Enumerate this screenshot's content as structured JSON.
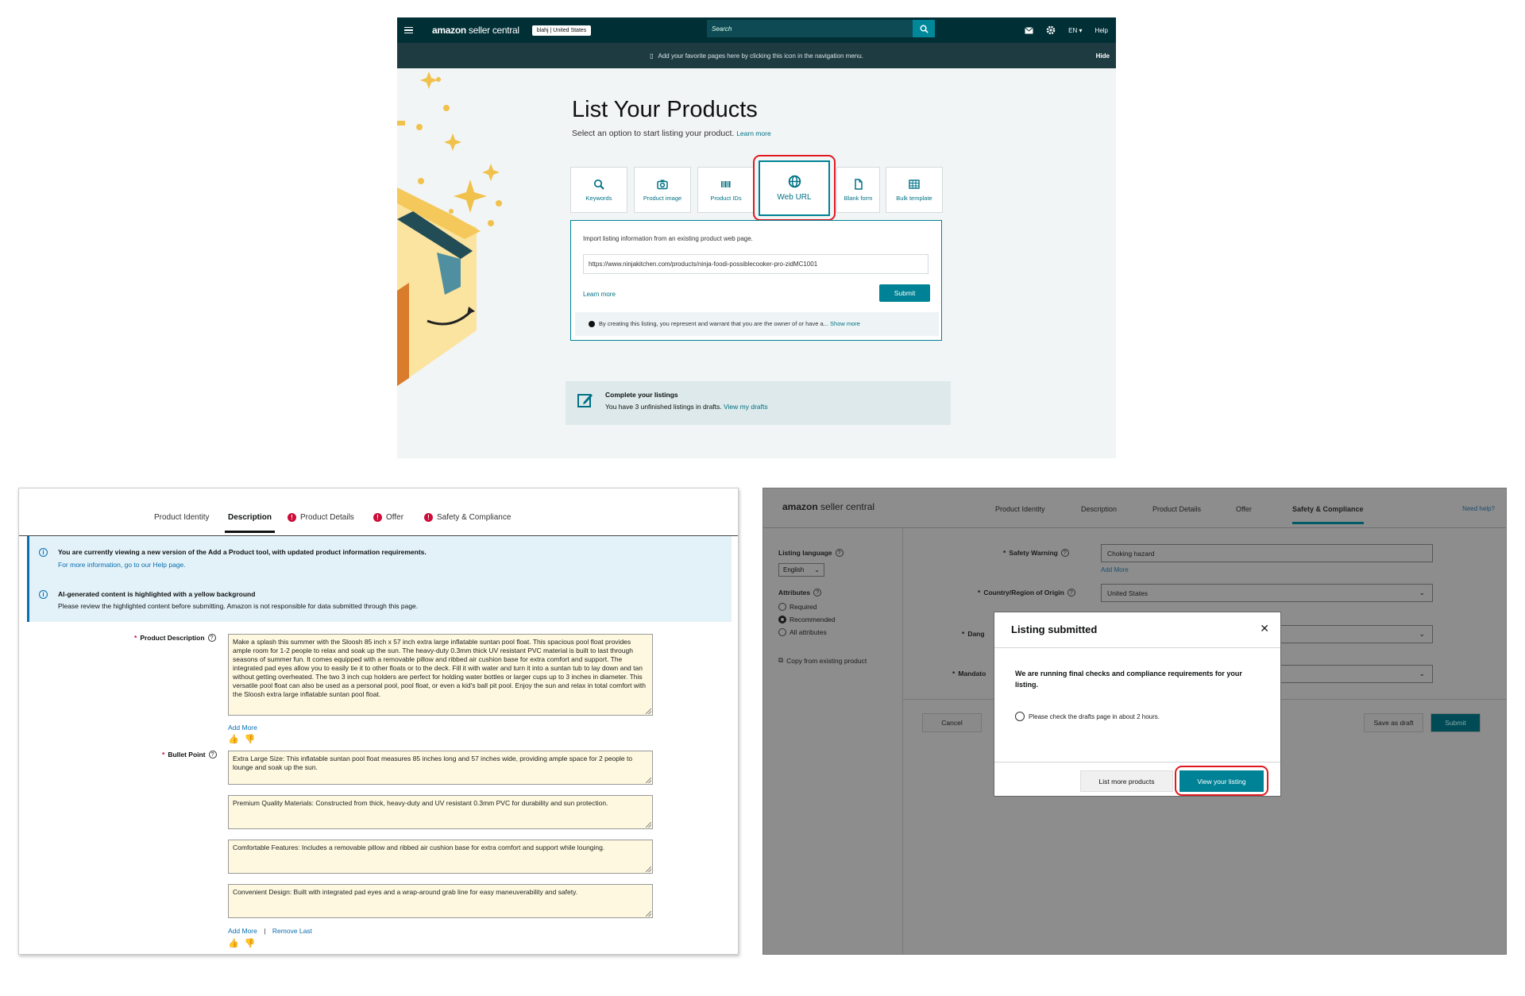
{
  "panel1": {
    "topbar": {
      "logo_main": "amazon",
      "logo_sub": " seller central",
      "marketplace": "blahj | United States",
      "search_placeholder": "Search",
      "language": "EN",
      "help": "Help"
    },
    "favbar": {
      "text": "Add your favorite pages here by clicking this icon in the navigation menu.",
      "hide": "Hide"
    },
    "title": "List Your Products",
    "subtitle": "Select an option to start listing your product.",
    "learn_more": "Learn more",
    "tiles": [
      {
        "label": "Keywords",
        "icon": "magnifier-icon"
      },
      {
        "label": "Product image",
        "icon": "camera-icon"
      },
      {
        "label": "Product IDs",
        "icon": "barcode-icon"
      },
      {
        "label": "Web URL",
        "icon": "globe-icon"
      },
      {
        "label": "Blank form",
        "icon": "document-icon"
      },
      {
        "label": "Bulk template",
        "icon": "spreadsheet-icon"
      }
    ],
    "url_panel": {
      "label": "Import listing information from an existing product web page.",
      "url_value": "https://www.ninjakitchen.com/products/ninja-foodi-possiblecooker-pro-zidMC1001",
      "learn_more": "Learn more",
      "submit": "Submit",
      "notice": "By creating this listing, you represent and warrant that you are the owner of or have a...",
      "show_more": "Show more"
    },
    "drafts": {
      "title": "Complete your listings",
      "text": "You have 3 unfinished listings in drafts.",
      "link": "View my drafts"
    }
  },
  "panel2": {
    "tabs": [
      {
        "label": "Product Identity",
        "error": false,
        "selected": false
      },
      {
        "label": "Description",
        "error": false,
        "selected": true
      },
      {
        "label": "Product Details",
        "error": true,
        "selected": false
      },
      {
        "label": "Offer",
        "error": true,
        "selected": false
      },
      {
        "label": "Safety & Compliance",
        "error": true,
        "selected": false
      }
    ],
    "info1_bold": "You are currently viewing a new version of the Add a Product tool, with updated product information requirements.",
    "info1_link": "For more information, go to our Help page.",
    "info2_bold": "AI-generated content is highlighted with a yellow background",
    "info2_text": "Please review the highlighted content before submitting. Amazon is not responsible for data submitted through this page.",
    "product_description_label": "Product Description",
    "product_description": "Make a splash this summer with the Sloosh 85 inch x 57 inch extra large inflatable suntan pool float. This spacious pool float provides ample room for 1-2 people to relax and soak up the sun. The heavy-duty 0.3mm thick UV resistant PVC material is built to last through seasons of summer fun. It comes equipped with a removable pillow and ribbed air cushion base for extra comfort and support. The integrated pad eyes allow you to easily tie it to other floats or to the deck. Fill it with water and turn it into a suntan tub to lay down and tan without getting overheated. The two 3 inch cup holders are perfect for holding water bottles or larger cups up to 3 inches in diameter. This versatile pool float can also be used as a personal pool, pool float, or even a kid's ball pit pool. Enjoy the sun and relax in total comfort with the Sloosh extra large inflatable suntan pool float.",
    "add_more": "Add More",
    "bullet_label": "Bullet Point",
    "bullets": [
      "Extra Large Size: This inflatable suntan pool float measures 85 inches long and 57 inches wide, providing ample space for 2 people to lounge and soak up the sun.",
      "Premium Quality Materials: Constructed from thick, heavy-duty and UV resistant 0.3mm PVC for durability and sun protection.",
      "Comfortable Features: Includes a removable pillow and ribbed air cushion base for extra comfort and support while lounging.",
      "Convenient Design: Built with integrated pad eyes and a wrap-around grab line for easy maneuverability and safety."
    ],
    "add_more_2": "Add More",
    "separator": "|",
    "remove_last": "Remove Last"
  },
  "panel3": {
    "logo_main": "amazon",
    "logo_sub": " seller central",
    "tabs": [
      "Product Identity",
      "Description",
      "Product Details",
      "Offer",
      "Safety & Compliance"
    ],
    "need_help": "Need help?",
    "listing_language_label": "Listing language",
    "listing_language_value": "English",
    "attributes_label": "Attributes",
    "attr_options": [
      "Required",
      "Recommended",
      "All attributes"
    ],
    "copy_existing": "Copy from existing product",
    "safety_warning_label": "Safety Warning",
    "safety_warning_value": "Choking hazard",
    "add_more": "Add More",
    "country_label": "Country/Region of Origin",
    "country_value": "United States",
    "dang_label": "Dang",
    "mandato_label": "Mandato",
    "cancel": "Cancel",
    "save_draft": "Save as draft",
    "submit": "Submit",
    "modal": {
      "title": "Listing submitted",
      "message": "We are running final checks and compliance requirements for your listing.",
      "note": "Please check the drafts page in about 2 hours.",
      "list_more": "List more products",
      "view_listing": "View your listing"
    }
  }
}
